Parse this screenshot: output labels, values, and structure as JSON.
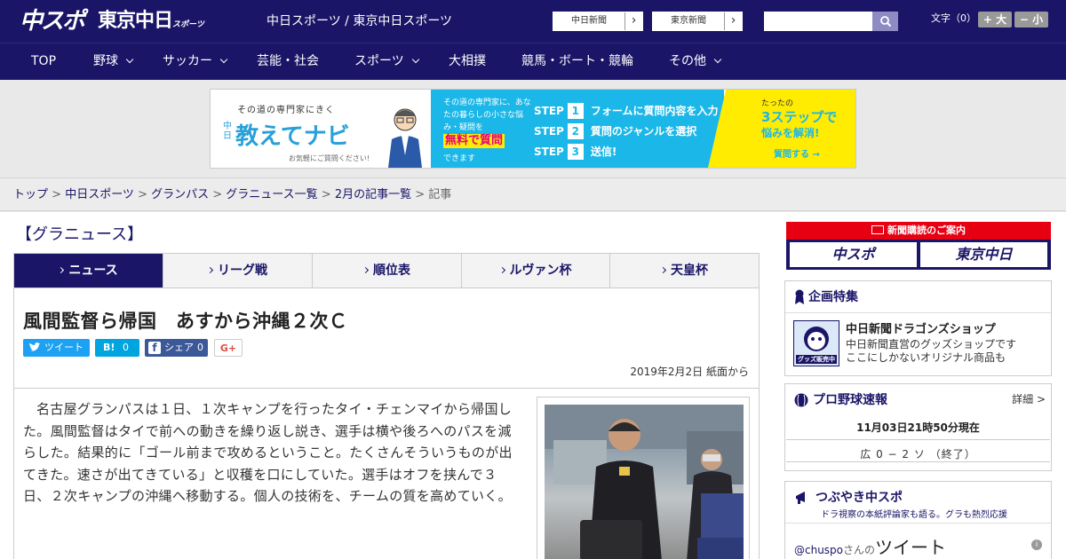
{
  "header": {
    "logo_chuspo": "中スポ",
    "logo_tokyo": "東京中日",
    "logo_tokyo_small": "スポーツ",
    "title": "中日スポーツ / 東京中日スポーツ",
    "link_chunichi": "中日新聞",
    "link_tokyo": "東京新聞",
    "link_arrow": "›",
    "search_placeholder": "",
    "font_size_label": "文字（0）",
    "font_larger": "+ 大",
    "font_smaller": "− 小"
  },
  "nav": {
    "items": [
      {
        "label": "TOP"
      },
      {
        "label": "野球"
      },
      {
        "label": "サッカー"
      },
      {
        "label": "芸能・社会"
      },
      {
        "label": "スポーツ"
      },
      {
        "label": "大相撲"
      },
      {
        "label": "競馬・ボート・競輪"
      },
      {
        "label": "その他"
      }
    ]
  },
  "ad": {
    "sub": "その道の専門家にきく",
    "brand_pre": "中日",
    "brand": "教えてナビ",
    "note": "お気軽にご質問ください!",
    "mid_text": "その道の専門家に、あなたの暮らしの小さな悩み・疑問を",
    "highlight": "無料で質問",
    "mid_text2": "できます",
    "steps": [
      {
        "label": "STEP",
        "n": "1",
        "text": "フォームに質問内容を入力"
      },
      {
        "label": "STEP",
        "n": "2",
        "text": "質問のジャンルを選択"
      },
      {
        "label": "STEP",
        "n": "3",
        "text": "送信!"
      }
    ],
    "r1": "たったの",
    "r2": "3ステップで",
    "r3": "悩みを解消!",
    "r4": "質問する →"
  },
  "breadcrumb": {
    "items": [
      "トップ",
      "中日スポーツ",
      "グランパス",
      "グラニュース一覧",
      "2月の記事一覧"
    ],
    "sep": " > ",
    "current": "記事"
  },
  "category_title": "【グラニュース】",
  "tabs": [
    {
      "label": "ニュース"
    },
    {
      "label": "リーグ戦"
    },
    {
      "label": "順位表"
    },
    {
      "label": "ルヴァン杯"
    },
    {
      "label": "天皇杯"
    }
  ],
  "article": {
    "headline": "風間監督ら帰国　あすから沖縄２次Ｃ",
    "share": {
      "tweet": "ツイート",
      "hatena": "B!",
      "hatena_count": "0",
      "facebook": "シェア",
      "facebook_count": "0",
      "google": "G+"
    },
    "date": "2019年2月2日 紙面から",
    "body": "名古屋グランパスは１日、１次キャンプを行ったタイ・チェンマイから帰国した。風間監督はタイで前への動きを繰り返し説き、選手は横や後ろへのパスを減らした。結果的に「ゴール前まで攻めるということ。たくさんそういうものが出てきた。速さが出てきている」と収穫を口にしていた。選手はオフを挟んで３日、２次キャンプの沖縄へ移動する。個人の技術を、チームの質を高めていく。"
  },
  "sidebar": {
    "subscription_title": "新聞購読のご案内",
    "sub_logo1": "中スポ",
    "sub_logo2": "東京中日",
    "special_title": "企画特集",
    "shop_icon_label": "グッズ販売中",
    "shop_title": "中日新聞ドラゴンズショップ",
    "shop_desc1": "中日新聞直営のグッズショップです",
    "shop_desc2": "ここにしかないオリジナル商品も",
    "baseball_title": "プロ野球速報",
    "baseball_detail": "詳細 >",
    "score_time": "11月03日21時50分現在",
    "score": "広 0 − 2 ソ （終了）",
    "tweet_title": "つぶやき中スポ",
    "tweet_sub": "ドラ視察の本紙評論家も語る。グラも熱烈応援",
    "tweet_handle": "@chuspo",
    "tweet_handle_suffix": "さんの",
    "tweet_word": "ツイート",
    "info": "i"
  },
  "colors": {
    "navy": "#1a1567",
    "red": "#e60012",
    "ad_blue": "#1bb7e8",
    "ad_yellow": "#ffec00",
    "twitter": "#1da1f2",
    "hatena": "#00a4de",
    "facebook": "#3b5998"
  }
}
